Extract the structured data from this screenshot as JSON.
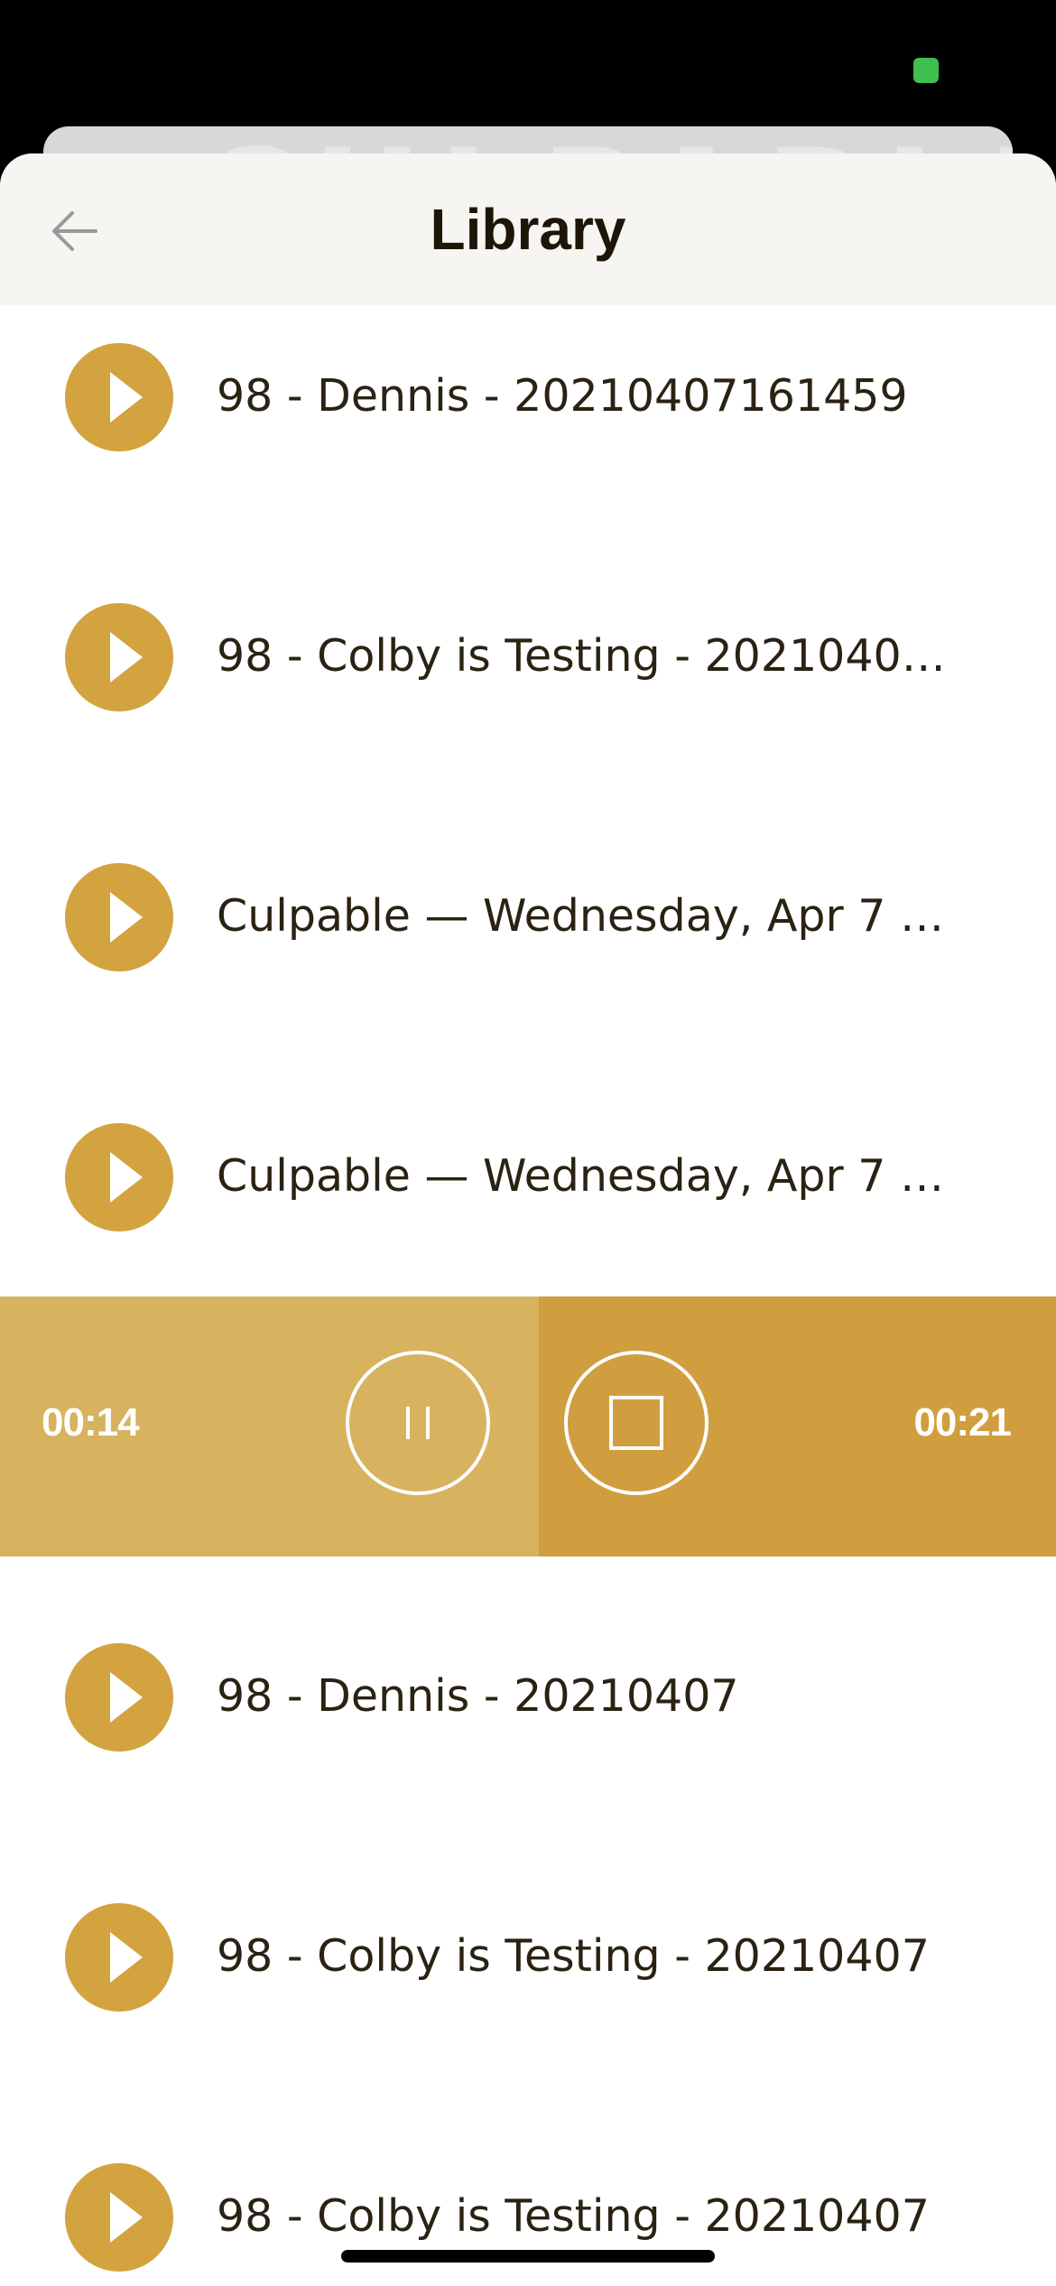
{
  "header": {
    "title": "Library"
  },
  "background_card": {
    "text": "CULPABLE"
  },
  "recordings": [
    {
      "label": "98 - Dennis - 20210407161459"
    },
    {
      "label": "98 - Colby is Testing - 202104071..."
    },
    {
      "label": "Culpable — Wednesday, Apr 7 @..."
    },
    {
      "label": "Culpable — Wednesday, Apr 7 @..."
    }
  ],
  "player": {
    "elapsed": "00:14",
    "total": "00:21",
    "progress_fraction": 0.51,
    "pause_icon": "pause-icon",
    "stop_icon": "stop-icon"
  },
  "recordings_after": [
    {
      "label": "98 - Dennis - 20210407"
    },
    {
      "label": "98 - Colby is Testing - 20210407"
    },
    {
      "label": "98 - Colby is Testing - 20210407"
    }
  ],
  "colors": {
    "accent": "#d2a33e",
    "player_bg": "#d09e3e",
    "player_progress": "#d7b25f",
    "header_bg": "#f6f5f2",
    "text": "#2a2212"
  }
}
